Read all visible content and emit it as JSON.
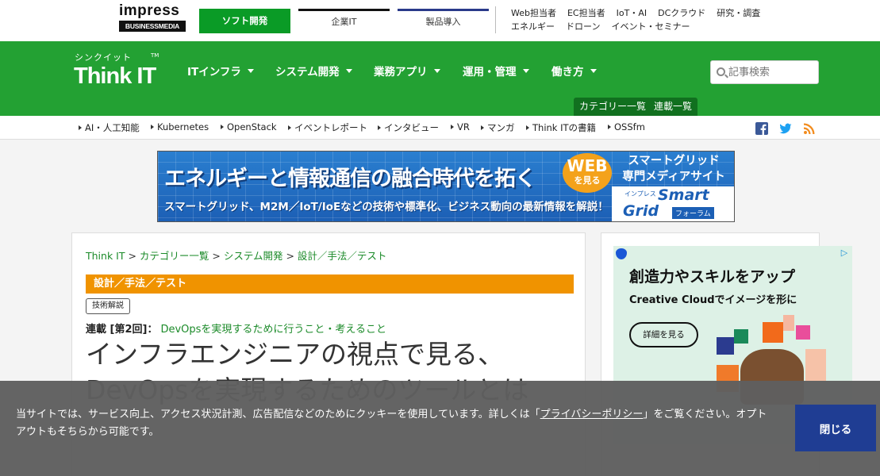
{
  "top": {
    "logo_word": "impress",
    "logo_sub": "BUSINESSMEDIA",
    "tabs": [
      "ソフト開発",
      "企業IT",
      "製品導入"
    ],
    "links_row1": [
      "Web担当者",
      "EC担当者",
      "IoT・AI",
      "DCクラウド",
      "研究・調査"
    ],
    "links_row2": [
      "エネルギー",
      "ドローン",
      "イベント・セミナー"
    ]
  },
  "header": {
    "brand_kana": "シンクイット",
    "brand_word": "Think IT",
    "brand_tm": "TM",
    "nav": [
      "ITインフラ",
      "システム開発",
      "業務アプリ",
      "運用・管理",
      "働き方"
    ],
    "search_placeholder": "記事検索",
    "pills": [
      "カテゴリー一覧",
      "連載一覧"
    ]
  },
  "keywords": [
    "AI・人工知能",
    "Kubernetes",
    "OpenStack",
    "イベントレポート",
    "インタビュー",
    "VR",
    "マンガ",
    "Think ITの書籍",
    "OSSfm"
  ],
  "banner": {
    "headline": "エネルギーと情報通信の融合時代を拓く",
    "sub": "スマートグリッド、M2M／IoT/IoEなどの技術や標準化、ビジネス動向の最新情報を解説！",
    "web_1": "WEB",
    "web_2": "を見る",
    "right_1": "スマートグリッド",
    "right_2": "専門メディアサイト",
    "logo_small": "インプレス",
    "logo_smart": "Smart",
    "logo_grid": "Grid",
    "logo_forum": "フォーラム"
  },
  "article": {
    "breadcrumbs": [
      "Think IT",
      "カテゴリー一覧",
      "システム開発",
      "設計／手法／テスト"
    ],
    "crumb_sep": " > ",
    "category": "設計／手法／テスト",
    "tag": "技術解説",
    "series_label": "連載 [第2回]：",
    "series_title": "DevOpsを実現するために行うこと・考えること",
    "title": "インフラエンジニアの視点で見る、DevOpsを実現するためのツールとは"
  },
  "ad": {
    "headline": "創造力やスキルをアップ",
    "sub": "Creative Cloudでイメージを形に",
    "button": "詳細を見る"
  },
  "cookie": {
    "text_before": "当サイトでは、サービス向上、アクセス状況計測、広告配信などのためにクッキーを使用しています。詳しくは「",
    "link": "プライバシーポリシー",
    "text_after": "」をご覧ください。オプトアウトもそちらから可能です。",
    "close": "閉じる"
  },
  "colors": {
    "brand_green": "#23a133",
    "dark_green": "#11701f",
    "category_orange": "#f09300",
    "close_button": "#1f3d93"
  }
}
